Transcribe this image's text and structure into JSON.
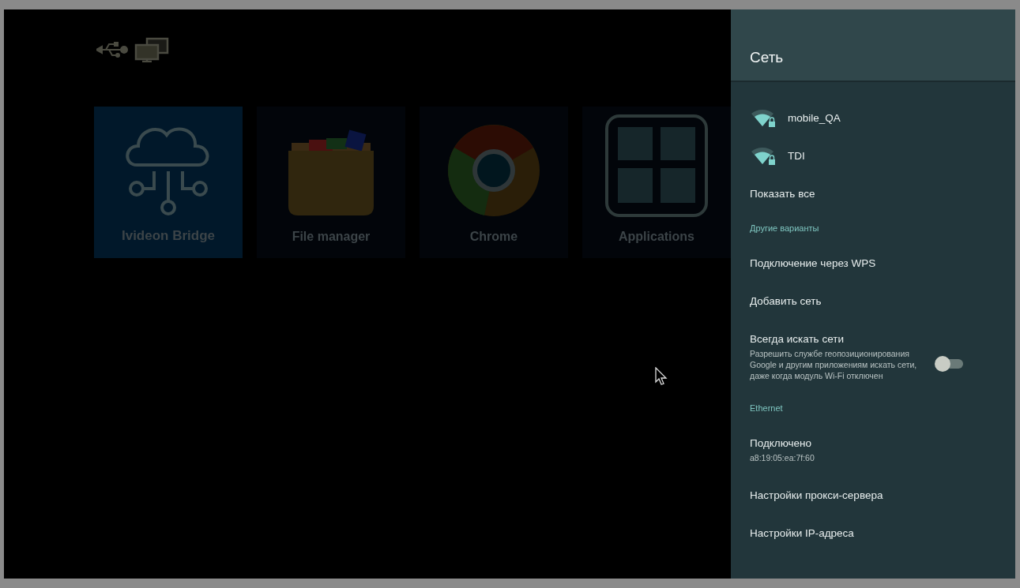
{
  "apps": [
    {
      "label": "Ivideon Bridge",
      "kind": "cloud",
      "selected": true
    },
    {
      "label": "File manager",
      "kind": "folder",
      "selected": false
    },
    {
      "label": "Chrome",
      "kind": "browser",
      "selected": false
    },
    {
      "label": "Applications",
      "kind": "grid",
      "selected": false
    }
  ],
  "panel": {
    "title": "Сеть",
    "items": [
      {
        "kind": "wifi",
        "title": "mobile_QA"
      },
      {
        "kind": "wifi",
        "title": "TDI"
      },
      {
        "kind": "link",
        "title": "Показать все"
      },
      {
        "kind": "section",
        "title": "Другие варианты"
      },
      {
        "kind": "link",
        "title": "Подключение через WPS"
      },
      {
        "kind": "link",
        "title": "Добавить сеть"
      },
      {
        "kind": "toggle",
        "title": "Всегда искать сети",
        "subtitle": "Разрешить службе геопозиционирования Google и другим приложениям искать сети, даже когда модуль Wi-Fi отключен",
        "on": false
      },
      {
        "kind": "section",
        "title": "Ethernet"
      },
      {
        "kind": "detail",
        "title": "Подключено",
        "subtitle": "a8:19:05:ea:7f:60"
      },
      {
        "kind": "link",
        "title": "Настройки прокси-сервера"
      },
      {
        "kind": "link",
        "title": "Настройки IP-адреса"
      }
    ]
  }
}
